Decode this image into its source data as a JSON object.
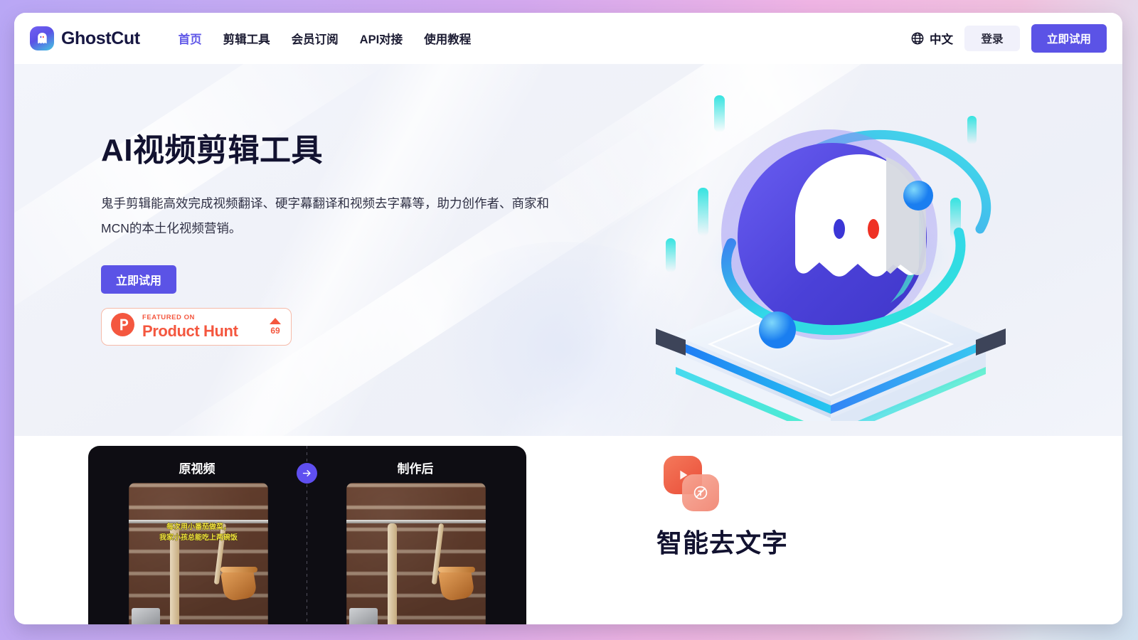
{
  "brand": {
    "name": "GhostCut",
    "logo_icon": "ghost-logo-icon"
  },
  "nav": {
    "items": [
      {
        "label": "首页",
        "active": true
      },
      {
        "label": "剪辑工具",
        "active": false
      },
      {
        "label": "会员订阅",
        "active": false
      },
      {
        "label": "API对接",
        "active": false
      },
      {
        "label": "使用教程",
        "active": false
      }
    ]
  },
  "header": {
    "language": {
      "icon": "globe-icon",
      "label": "中文"
    },
    "login_label": "登录",
    "cta_label": "立即试用"
  },
  "hero": {
    "title": "AI视频剪辑工具",
    "subtitle": "鬼手剪辑能高效完成视频翻译、硬字幕翻译和视频去字幕等，助力创作者、商家和MCN的本土化视频营销。",
    "cta_label": "立即试用",
    "product_hunt": {
      "featured_label": "FEATURED ON",
      "name": "Product Hunt",
      "votes": "69",
      "logo_icon": "product-hunt-icon",
      "upvote_icon": "triangle-up-icon"
    },
    "illustration_icon": "ghost-planet-illustration"
  },
  "features": {
    "compare": {
      "left_title": "原视频",
      "right_title": "制作后",
      "arrow_icon": "arrow-right-icon",
      "subtitle_line1": "每次用小番茄做菜，",
      "subtitle_line2": "我家小孩总能吃上两碗饭"
    },
    "block": {
      "icon_primary": "video-play-icon",
      "icon_secondary": "no-text-icon",
      "title": "智能去文字"
    }
  },
  "colors": {
    "accent": "#5b53e6",
    "accent_light": "#f1f1fb",
    "product_hunt": "#f4573f",
    "nav_active": "#6159e8",
    "dark_card": "#0e0d13",
    "subtitle_yellow": "#f5e63c"
  }
}
